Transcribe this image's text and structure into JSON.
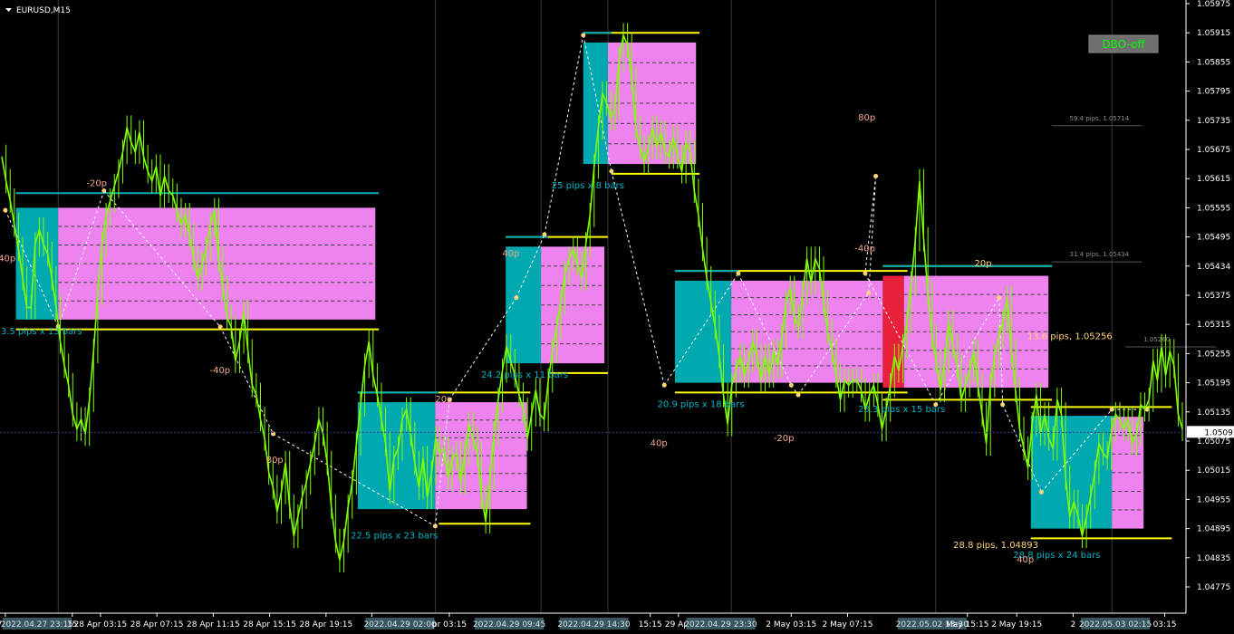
{
  "window": {
    "title": "EURUSD,M15",
    "menu_icon": "triangle-down-icon"
  },
  "dbo_button": {
    "label": "DBO-off"
  },
  "colors": {
    "background": "#000000",
    "price": "#7fff00",
    "box_fill": "#ee82ee",
    "box_range": "#00a8b0",
    "box_range_red": "#e8203c",
    "level": "#ffff00",
    "level_top": "#00aab8",
    "label_cyan": "#00b4c8",
    "label_salmon": "#f4a890",
    "label_gold": "#ffd37a",
    "label_gray": "#8c8c8c"
  },
  "chart_data": {
    "type": "line",
    "symbol": "EURUSD",
    "timeframe": "M15",
    "ylim": [
      1.04775,
      1.05975
    ],
    "y_ticks": [
      "1.05975",
      "1.05915",
      "1.05855",
      "1.05795",
      "1.05735",
      "1.05675",
      "1.05615",
      "1.05555",
      "1.05495",
      "1.05434",
      "1.05375",
      "1.05315",
      "1.05255",
      "1.05195",
      "1.05135",
      "1.05075",
      "1.05015",
      "1.04955",
      "1.04895",
      "1.04835",
      "1.04775"
    ],
    "current_price": "1.05093",
    "x_ticks": [
      {
        "i": 1,
        "text": "27 Apr"
      },
      {
        "i": 10,
        "text": "2022.04.27 23:15"
      },
      {
        "i": 20,
        "text": "15"
      },
      {
        "i": 28,
        "text": "28 Apr 03:15"
      },
      {
        "i": 44,
        "text": "28 Apr 07:15"
      },
      {
        "i": 60,
        "text": "28 Apr 11:15"
      },
      {
        "i": 76,
        "text": "28 Apr 15:15"
      },
      {
        "i": 92,
        "text": "28 Apr 19:15"
      },
      {
        "i": 105,
        "text": "2"
      },
      {
        "i": 113,
        "text": "2022.04.29 02:00"
      },
      {
        "i": 127,
        "text": "pr 03:15"
      },
      {
        "i": 144,
        "text": "2022.04.29 09:45"
      },
      {
        "i": 168,
        "text": "2022.04.29 14:30"
      },
      {
        "i": 184,
        "text": "15:15"
      },
      {
        "i": 192,
        "text": "29 Apr"
      },
      {
        "i": 204,
        "text": "2022.04.29 23:30"
      },
      {
        "i": 224,
        "text": "2 May 03:15"
      },
      {
        "i": 240,
        "text": "2 May 07:15"
      },
      {
        "i": 264,
        "text": "2022.05.02 13:30"
      },
      {
        "i": 274,
        "text": "May 15:15"
      },
      {
        "i": 288,
        "text": "2 May 19:15"
      },
      {
        "i": 304,
        "text": "2"
      },
      {
        "i": 316,
        "text": "2022.05.03 02:15"
      },
      {
        "i": 330,
        "text": "03:15"
      }
    ],
    "price_series": [
      1.0566,
      1.0561,
      1.0557,
      1.0552,
      1.0547,
      1.0541,
      1.0535,
      1.0535,
      1.0548,
      1.0551,
      1.0548,
      1.0546,
      1.0541,
      1.0535,
      1.0528,
      1.0523,
      1.0519,
      1.0513,
      1.051,
      1.0512,
      1.0509,
      1.0516,
      1.0526,
      1.0538,
      1.0548,
      1.0554,
      1.0557,
      1.056,
      1.0563,
      1.0567,
      1.0572,
      1.0569,
      1.0567,
      1.0571,
      1.0566,
      1.0563,
      1.0561,
      1.0564,
      1.0558,
      1.0562,
      1.0559,
      1.0558,
      1.0555,
      1.0552,
      1.0554,
      1.055,
      1.0545,
      1.0541,
      1.0544,
      1.0547,
      1.0552,
      1.0555,
      1.0545,
      1.0539,
      1.0533,
      1.0531,
      1.0524,
      1.0528,
      1.0534,
      1.0526,
      1.0519,
      1.0517,
      1.0512,
      1.0508,
      1.0501,
      1.0498,
      1.0493,
      1.0497,
      1.0503,
      1.0494,
      1.0488,
      1.0492,
      1.0496,
      1.0499,
      1.0503,
      1.0507,
      1.0512,
      1.0509,
      1.0503,
      1.0494,
      1.0487,
      1.0483,
      1.0487,
      1.0494,
      1.0499,
      1.0507,
      1.0515,
      1.0523,
      1.0528,
      1.0521,
      1.0517,
      1.0512,
      1.0507,
      1.0497,
      1.0504,
      1.0506,
      1.0512,
      1.0514,
      1.0509,
      1.0503,
      1.0498,
      1.0504,
      1.0496,
      1.0501,
      1.0508,
      1.0505,
      1.0506,
      1.05,
      1.0504,
      1.0505,
      1.0499,
      1.0505,
      1.0511,
      1.0508,
      1.0505,
      1.0496,
      1.0491,
      1.05,
      1.0509,
      1.0516,
      1.0522,
      1.0527,
      1.0524,
      1.0521,
      1.0517,
      1.0514,
      1.0508,
      1.0513,
      1.0518,
      1.0513,
      1.0512,
      1.052,
      1.0526,
      1.0531,
      1.0536,
      1.0542,
      1.0545,
      1.0547,
      1.0544,
      1.0541,
      1.0548,
      1.0554,
      1.0564,
      1.0572,
      1.0579,
      1.0577,
      1.0574,
      1.0576,
      1.0586,
      1.0591,
      1.0589,
      1.0582,
      1.0572,
      1.0568,
      1.0565,
      1.0568,
      1.0572,
      1.0568,
      1.0571,
      1.0567,
      1.0566,
      1.057,
      1.0566,
      1.0563,
      1.0569,
      1.0567,
      1.0559,
      1.0554,
      1.0547,
      1.0541,
      1.0536,
      1.0531,
      1.0525,
      1.0517,
      1.0511,
      1.0519,
      1.0522,
      1.0525,
      1.0521,
      1.0524,
      1.0528,
      1.0525,
      1.052,
      1.0525,
      1.0521,
      1.0526,
      1.0523,
      1.0529,
      1.0536,
      1.0539,
      1.0533,
      1.0531,
      1.0538,
      1.0545,
      1.054,
      1.0545,
      1.0543,
      1.0536,
      1.053,
      1.0526,
      1.0521,
      1.0516,
      1.052,
      1.0519,
      1.052,
      1.052,
      1.0518,
      1.0514,
      1.0517,
      1.0519,
      1.0515,
      1.051,
      1.0514,
      1.0519,
      1.0525,
      1.0522,
      1.0527,
      1.0532,
      1.054,
      1.0549,
      1.0561,
      1.0549,
      1.0538,
      1.0529,
      1.0524,
      1.0518,
      1.0524,
      1.0532,
      1.0527,
      1.0523,
      1.0516,
      1.0519,
      1.0522,
      1.0526,
      1.0519,
      1.0513,
      1.0507,
      1.0519,
      1.0525,
      1.0529,
      1.0532,
      1.0537,
      1.0526,
      1.0518,
      1.051,
      1.0506,
      1.0502,
      1.0511,
      1.0517,
      1.0509,
      1.0513,
      1.0508,
      1.0506,
      1.0516,
      1.0513,
      1.05,
      1.0492,
      1.0495,
      1.0492,
      1.0488,
      1.0492,
      1.0496,
      1.0501,
      1.0507,
      1.0505,
      1.0504,
      1.051,
      1.0513,
      1.0512,
      1.051,
      1.0512,
      1.0507,
      1.0509,
      1.0515,
      1.0514,
      1.0516,
      1.0524,
      1.052,
      1.0527,
      1.0521,
      1.0526,
      1.0523,
      1.0513,
      1.051
    ],
    "index_range": [
      0,
      335
    ],
    "vertical_gridlines": [
      16,
      123,
      153,
      172,
      207,
      265,
      315
    ],
    "boxes": [
      {
        "x0": 4,
        "x1": 16,
        "x2": 106,
        "top": 1.05555,
        "bottom": 1.05325,
        "range_color": "range"
      },
      {
        "x0": 101,
        "x1": 123,
        "x2": 149,
        "top": 1.05155,
        "bottom": 1.04935,
        "range_color": "range"
      },
      {
        "x0": 143,
        "x1": 153,
        "x2": 171,
        "top": 1.05475,
        "bottom": 1.05235,
        "range_color": "range"
      },
      {
        "x0": 165,
        "x1": 172,
        "x2": 197,
        "top": 1.05895,
        "bottom": 1.05645,
        "range_color": "range"
      },
      {
        "x0": 191,
        "x1": 207,
        "x2": 250,
        "top": 1.05405,
        "bottom": 1.05195,
        "range_color": "range"
      },
      {
        "x0": 250,
        "x1": 256,
        "x2": 297,
        "top": 1.05415,
        "bottom": 1.05185,
        "range_color": "red"
      },
      {
        "x0": 292,
        "x1": 315,
        "x2": 324,
        "top": 1.05125,
        "bottom": 1.04895,
        "range_color": "range"
      }
    ],
    "levels": [
      {
        "x0": 4,
        "x1": 107,
        "y": 1.05585,
        "color": "top"
      },
      {
        "x0": 4,
        "x1": 107,
        "y": 1.05305,
        "color": "level"
      },
      {
        "x0": 101,
        "x1": 150,
        "y": 1.05175,
        "color": "level"
      },
      {
        "x0": 101,
        "x1": 124,
        "y": 1.05175,
        "color": "top"
      },
      {
        "x0": 124,
        "x1": 150,
        "y": 1.04905,
        "color": "level"
      },
      {
        "x0": 143,
        "x1": 172,
        "y": 1.05495,
        "color": "level"
      },
      {
        "x0": 143,
        "x1": 155,
        "y": 1.05495,
        "color": "top"
      },
      {
        "x0": 155,
        "x1": 172,
        "y": 1.05215,
        "color": "level"
      },
      {
        "x0": 165,
        "x1": 198,
        "y": 1.05915,
        "color": "level"
      },
      {
        "x0": 165,
        "x1": 173,
        "y": 1.05915,
        "color": "top"
      },
      {
        "x0": 173,
        "x1": 198,
        "y": 1.05625,
        "color": "level"
      },
      {
        "x0": 191,
        "x1": 257,
        "y": 1.05425,
        "color": "level"
      },
      {
        "x0": 191,
        "x1": 209,
        "y": 1.05425,
        "color": "top"
      },
      {
        "x0": 191,
        "x1": 257,
        "y": 1.05175,
        "color": "level"
      },
      {
        "x0": 250,
        "x1": 298,
        "y": 1.05435,
        "color": "level"
      },
      {
        "x0": 250,
        "x1": 298,
        "y": 1.05435,
        "color": "top"
      },
      {
        "x0": 250,
        "x1": 298,
        "y": 1.0516,
        "color": "level"
      },
      {
        "x0": 292,
        "x1": 332,
        "y": 1.05145,
        "color": "level"
      },
      {
        "x0": 292,
        "x1": 316,
        "y": 1.05125,
        "color": "top"
      },
      {
        "x0": 292,
        "x1": 332,
        "y": 1.04875,
        "color": "level"
      }
    ],
    "zigzag": [
      [
        1,
        1.0555
      ],
      [
        16,
        1.0531
      ],
      [
        29,
        1.0559
      ],
      [
        62,
        1.0531
      ],
      [
        77,
        1.0509
      ],
      [
        123,
        1.049
      ],
      [
        127,
        1.0516
      ],
      [
        146,
        1.0537
      ],
      [
        154,
        1.055
      ],
      [
        165,
        1.0591
      ],
      [
        173,
        1.0563
      ],
      [
        188,
        1.0519
      ],
      [
        209,
        1.0542
      ],
      [
        224,
        1.0519
      ],
      [
        226,
        1.0517
      ],
      [
        246,
        1.0538
      ],
      [
        248,
        1.0562
      ],
      [
        245,
        1.0542
      ],
      [
        265,
        1.0515
      ],
      [
        283,
        1.0537
      ],
      [
        284,
        1.0515
      ],
      [
        295,
        1.0497
      ],
      [
        315,
        1.0514
      ],
      [
        325,
        1.0514
      ]
    ],
    "labels": [
      {
        "text": "-20p",
        "i": 24,
        "y": 1.056,
        "color": "salmon"
      },
      {
        "text": "40p",
        "i": -1,
        "y": 1.05445,
        "color": "salmon"
      },
      {
        "text": "3.5 pips x 13 bars",
        "i": -0.3,
        "y": 1.05295,
        "color": "cyan"
      },
      {
        "text": "-40p",
        "i": 59,
        "y": 1.05215,
        "color": "salmon"
      },
      {
        "text": "80p",
        "i": 75,
        "y": 1.0503,
        "color": "salmon"
      },
      {
        "text": "22.5 pips x 23 bars",
        "i": 99,
        "y": 1.04875,
        "color": "cyan"
      },
      {
        "text": "20p",
        "i": 123,
        "y": 1.05155,
        "color": "salmon"
      },
      {
        "text": "24.2 pips x 11 bars",
        "i": 136,
        "y": 1.05205,
        "color": "cyan"
      },
      {
        "text": "40p",
        "i": 142,
        "y": 1.05455,
        "color": "salmon"
      },
      {
        "text": "25 pips x 8 bars",
        "i": 156,
        "y": 1.05595,
        "color": "cyan"
      },
      {
        "text": "80p",
        "i": 243,
        "y": 1.05735,
        "color": "salmon"
      },
      {
        "text": "-40p",
        "i": 242,
        "y": 1.05465,
        "color": "salmon"
      },
      {
        "text": "20.9 pips x 18 bars",
        "i": 186,
        "y": 1.05145,
        "color": "cyan"
      },
      {
        "text": "40p",
        "i": 184,
        "y": 1.05065,
        "color": "salmon"
      },
      {
        "text": "-20p",
        "i": 219,
        "y": 1.05075,
        "color": "salmon"
      },
      {
        "text": "23.3 pips x 15 bars",
        "i": 243,
        "y": 1.05135,
        "color": "cyan"
      },
      {
        "text": "20p",
        "i": 276,
        "y": 1.05435,
        "color": "gold"
      },
      {
        "text": "13.6 pips, 1.05256",
        "i": 291,
        "y": 1.05285,
        "color": "gold"
      },
      {
        "text": "28.8 pips, 1.04893",
        "i": 270,
        "y": 1.04855,
        "color": "gold"
      },
      {
        "text": "28.8 pips x 24 bars",
        "i": 287,
        "y": 1.04835,
        "color": "cyan"
      },
      {
        "text": "40p",
        "i": 288,
        "y": 1.04825,
        "color": "salmon"
      }
    ],
    "gray_notes": [
      {
        "text": "59.4 pips, 1.05714",
        "i": 303,
        "y": 1.05735
      },
      {
        "text": "31.4 pips, 1.05434",
        "i": 303,
        "y": 1.05455
      },
      {
        "text": "1.05260",
        "i": 324,
        "y": 1.0528
      }
    ]
  }
}
